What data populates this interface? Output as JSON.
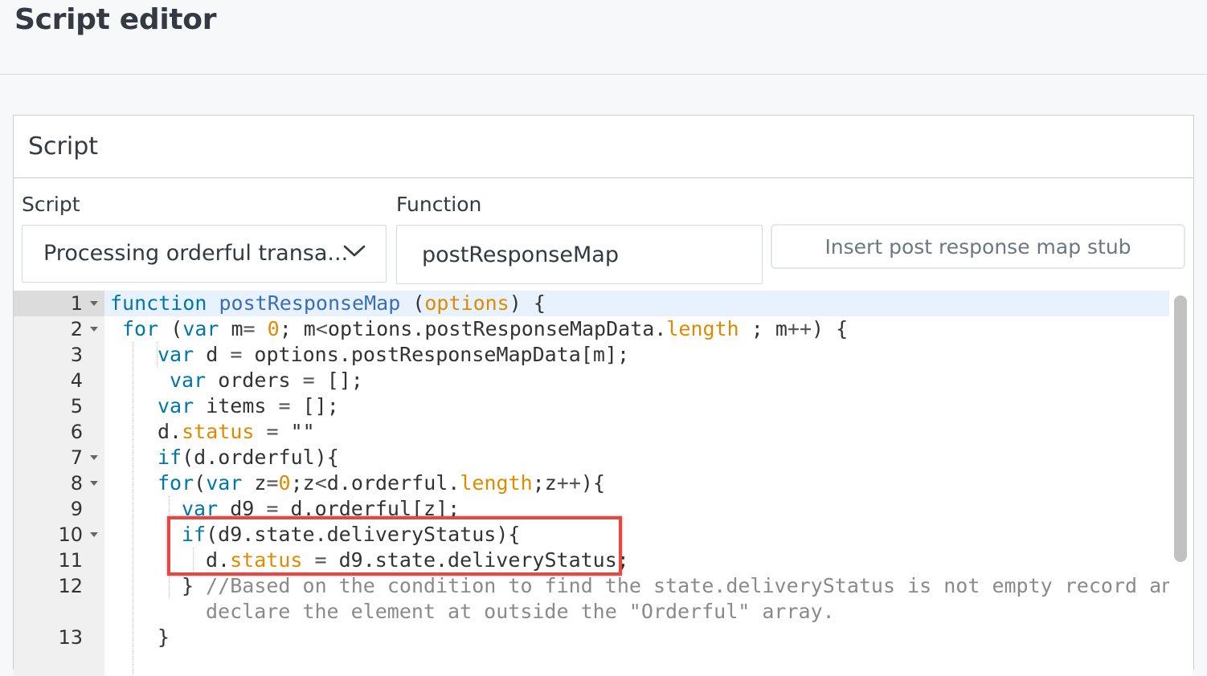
{
  "page": {
    "title": "Script editor"
  },
  "panel": {
    "title": "Script"
  },
  "form": {
    "script_label": "Script",
    "script_selected": "Processing orderful transa...",
    "function_label": "Function",
    "function_value": "postResponseMap",
    "stub_button_label": "Insert post response map stub"
  },
  "icons": {
    "dropdown": "chevron-down-icon",
    "fold": "fold-caret-icon"
  },
  "colors": {
    "keyword": "#0077aa",
    "property": "#e08a00",
    "highlight_border": "#e8463e"
  },
  "editor": {
    "line_numbers": [
      "1",
      "2",
      "3",
      "4",
      "5",
      "6",
      "7",
      "8",
      "9",
      "10",
      "11",
      "12",
      "13"
    ],
    "lines": {
      "l1": {
        "kw": "function",
        "fn": "postResponseMap",
        "p1": " (",
        "arg": "options",
        "p2": ") {"
      },
      "l2": {
        "kw": "for",
        "p1": " (",
        "kw2": "var",
        "p2": " m",
        "op": "=",
        "num": " 0",
        "p3": "; m",
        "op2": "<",
        "p4": "options.postResponseMapData.",
        "prop": "length",
        "p5": " ; m",
        "op3": "++",
        "p6": ") {"
      },
      "l3": {
        "kw": "var",
        "p1": " d ",
        "op": "=",
        "p2": " options.postResponseMapData[m];"
      },
      "l4": {
        "kw": "var",
        "p1": " orders ",
        "op": "=",
        "p2": " [];"
      },
      "l5": {
        "kw": "var",
        "p1": " items ",
        "op": "=",
        "p2": " [];"
      },
      "l6": {
        "p1": "d.",
        "prop": "status",
        "p2": " ",
        "op": "=",
        "p3": " \"\""
      },
      "l7": {
        "kw": "if",
        "p1": "(d.orderful){"
      },
      "l8": {
        "kw": "for",
        "p1": "(",
        "kw2": "var",
        "p2": " z",
        "op": "=",
        "num": "0",
        "p3": ";z",
        "op2": "<",
        "p4": "d.orderful.",
        "prop": "length",
        "p5": ";z",
        "op3": "++",
        "p6": "){"
      },
      "l9": {
        "kw": "var",
        "p1": " d9 ",
        "op": "=",
        "p2": " d.orderful[z];"
      },
      "l10": {
        "kw": "if",
        "p1": "(d9.state.deliveryStatus){"
      },
      "l11": {
        "p1": "d.",
        "prop": "status",
        "p2": " ",
        "op": "=",
        "p3": " d9.state.deliveryStatus;"
      },
      "l12": {
        "p1": "} ",
        "cm1": "//Based on the condition to find the state.deliveryStatus is not empty record and",
        "cm2": "declare the element at outside the \"Orderful\" array."
      },
      "l13": {
        "p1": "}"
      }
    }
  }
}
